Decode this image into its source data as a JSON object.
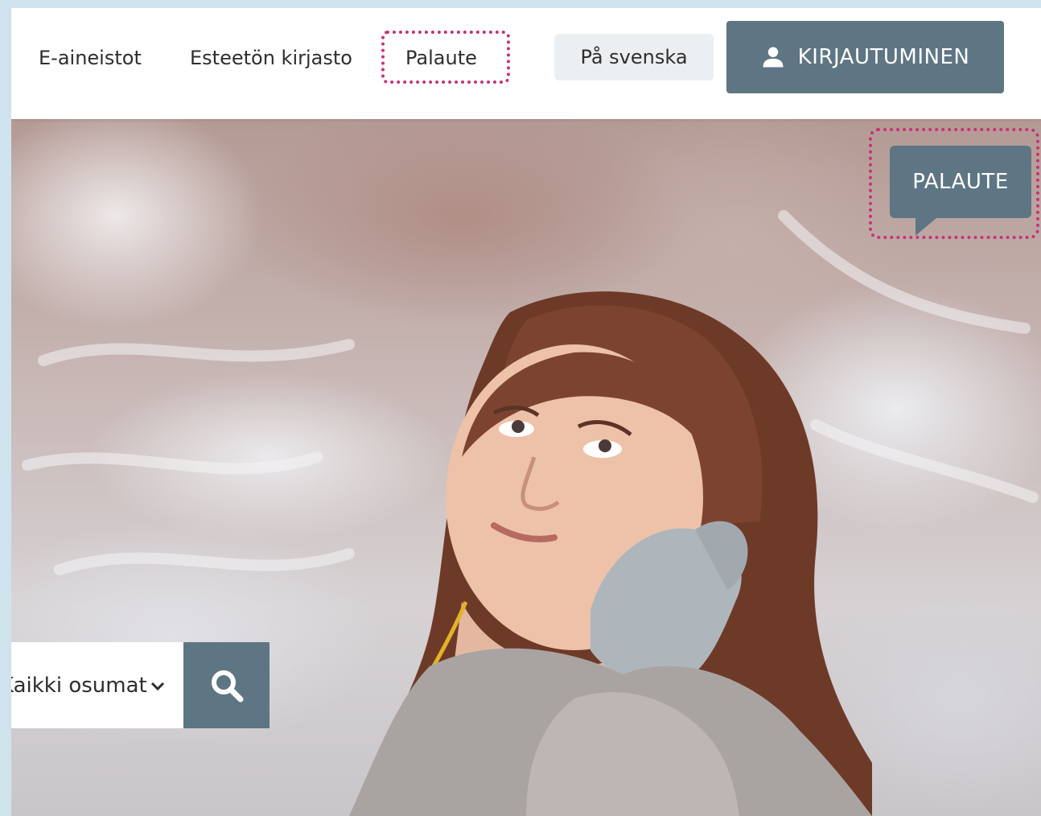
{
  "nav": {
    "items": [
      {
        "label": "E-aineistot"
      },
      {
        "label": "Esteetön kirjasto"
      },
      {
        "label": "Palaute"
      }
    ],
    "language_label": "På svenska",
    "login_label": "KIRJAUTUMINEN"
  },
  "feedback": {
    "label": "PALAUTE"
  },
  "search": {
    "scope_selected": "Kaikki osumat"
  },
  "colors": {
    "accent": "#5e7584",
    "highlight_dashed": "#c9317b",
    "frame_border": "#cfe3ee"
  }
}
